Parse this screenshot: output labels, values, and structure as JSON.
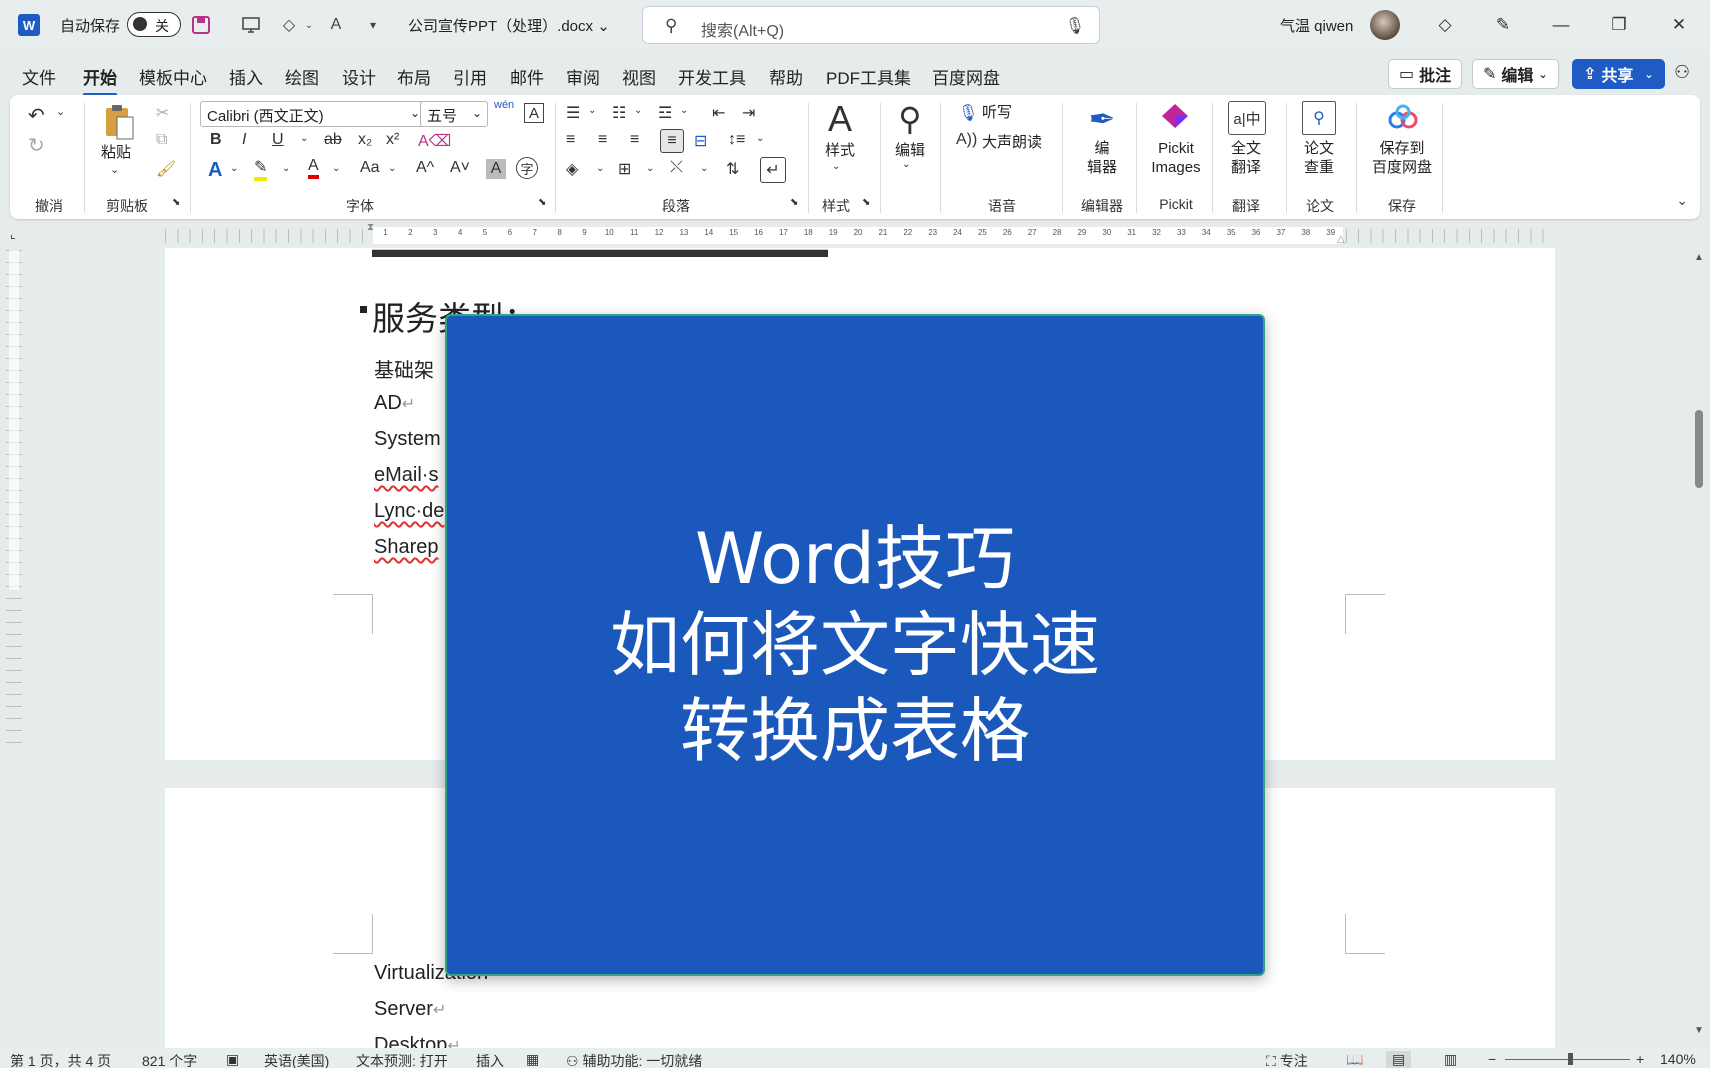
{
  "titlebar": {
    "app_logo": "W",
    "autosave_label": "自动保存",
    "autosave_state": "关",
    "document_title": "公司宣传PPT（处理）.docx",
    "search_placeholder": "搜索(Alt+Q)",
    "user_name": "气温 qiwen"
  },
  "menu": {
    "tabs": [
      "文件",
      "开始",
      "模板中心",
      "插入",
      "绘图",
      "设计",
      "布局",
      "引用",
      "邮件",
      "审阅",
      "视图",
      "开发工具",
      "帮助",
      "PDF工具集",
      "百度网盘"
    ],
    "active_tab": "开始",
    "comment_label": "批注",
    "edit_label": "编辑",
    "share_label": "共享"
  },
  "ribbon": {
    "groups": {
      "undo": "撤消",
      "clipboard": "剪贴板",
      "font": "字体",
      "paragraph": "段落",
      "styles": "样式",
      "voice": "语音",
      "editor": "编辑器",
      "pickit": "Pickit",
      "translate": "翻译",
      "paper": "论文",
      "save": "保存"
    },
    "paste_label": "粘贴",
    "font_name": "Calibri (西文正文)",
    "font_size": "五号",
    "styles_label": "样式",
    "editing_label": "编辑",
    "dictate_label": "听写",
    "read_aloud_label": "大声朗读",
    "editor_btn_line1": "编",
    "editor_btn_line2": "辑器",
    "pickit_line1": "Pickit",
    "pickit_line2": "Images",
    "translate_line1": "全文",
    "translate_line2": "翻译",
    "paper_line1": "论文",
    "paper_line2": "查重",
    "baidu_line1": "保存到",
    "baidu_line2": "百度网盘"
  },
  "document": {
    "heading": "服务类型：",
    "lines": [
      "基础架",
      "AD",
      "System",
      "eMail·s",
      "Lync·de",
      "Sharep"
    ],
    "page2_lines": [
      "Virtualization",
      "Server",
      "Desktop"
    ]
  },
  "overlay": {
    "line1": "Word技巧",
    "line2": "如何将文字快速",
    "line3": "转换成表格",
    "bg_color": "#1a59bb"
  },
  "statusbar": {
    "page_info": "第 1 页，共 4 页",
    "word_count": "821 个字",
    "language": "英语(美国)",
    "text_prediction": "文本预测: 打开",
    "insert_mode": "插入",
    "accessibility": "辅助功能: 一切就绪",
    "focus": "专注",
    "zoom": "140%"
  },
  "colors": {
    "accent": "#1f5bc4",
    "overlay_border": "#2ea58a"
  }
}
